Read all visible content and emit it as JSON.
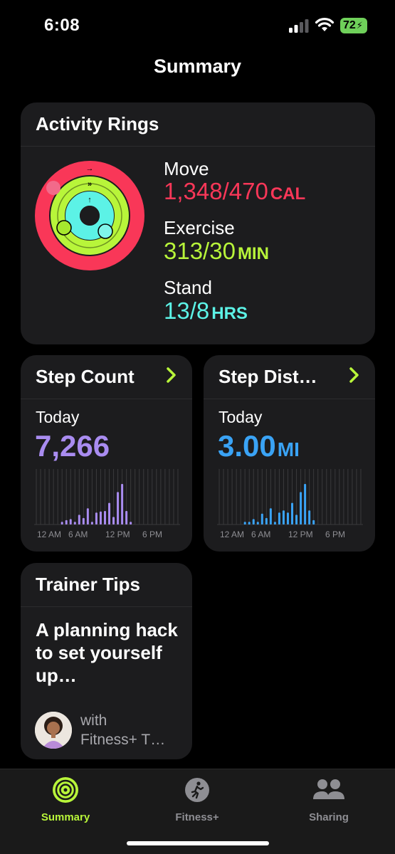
{
  "status": {
    "time": "6:08",
    "battery": "72"
  },
  "page_title": "Summary",
  "activity": {
    "title": "Activity Rings",
    "move": {
      "label": "Move",
      "value": "1,348/470",
      "unit": "CAL"
    },
    "exercise": {
      "label": "Exercise",
      "value": "313/30",
      "unit": "MIN"
    },
    "stand": {
      "label": "Stand",
      "value": "13/8",
      "unit": "HRS"
    },
    "colors": {
      "move": "#f93758",
      "exercise": "#b8f53a",
      "stand": "#5cf2e6"
    }
  },
  "step_count": {
    "title": "Step Count",
    "period": "Today",
    "value": "7,266",
    "color": "#a98cf0",
    "axis_labels": [
      "12 AM",
      "6 AM",
      "12 PM",
      "6 PM"
    ],
    "bars": [
      0,
      0,
      0,
      0,
      0,
      0,
      0.05,
      0.08,
      0.1,
      0.05,
      0.18,
      0.12,
      0.3,
      0.05,
      0.22,
      0.24,
      0.25,
      0.4,
      0.14,
      0.6,
      0.75,
      0.25,
      0.05,
      0,
      0,
      0,
      0,
      0,
      0,
      0,
      0,
      0,
      0,
      0
    ]
  },
  "step_distance": {
    "title": "Step Dist…",
    "period": "Today",
    "value": "3.00",
    "unit": "MI",
    "color": "#3aa3f5",
    "axis_labels": [
      "12 AM",
      "6 AM",
      "12 PM",
      "6 PM"
    ],
    "bars": [
      0,
      0,
      0,
      0,
      0,
      0,
      0.05,
      0.05,
      0.1,
      0.05,
      0.2,
      0.12,
      0.3,
      0.05,
      0.22,
      0.26,
      0.22,
      0.4,
      0.18,
      0.6,
      0.75,
      0.26,
      0.08,
      0,
      0,
      0,
      0,
      0,
      0,
      0,
      0,
      0,
      0,
      0
    ]
  },
  "trainer": {
    "title": "Trainer Tips",
    "tip": "A planning hack to set yourself up…",
    "with_line1": "with",
    "with_line2": "Fitness+ T…"
  },
  "tabs": [
    {
      "label": "Summary",
      "icon": "summary-rings-icon",
      "active": true
    },
    {
      "label": "Fitness+",
      "icon": "runner-icon",
      "active": false
    },
    {
      "label": "Sharing",
      "icon": "people-icon",
      "active": false
    }
  ]
}
